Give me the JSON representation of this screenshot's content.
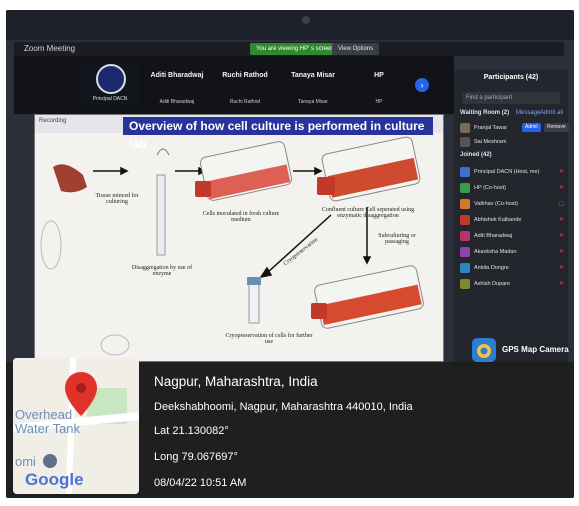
{
  "window": {
    "app_title": "Zoom Meeting",
    "viewing_banner": "You are viewing HP' s screen",
    "view_options": "View Options"
  },
  "video_strip": {
    "host_caption": "Principal DACN",
    "participants": [
      {
        "name": "Aditi Bharadwaj",
        "sub": "Aditi Bharadwaj"
      },
      {
        "name": "Ruchi Rathod",
        "sub": "Ruchi Rathod"
      },
      {
        "name": "Tanaya Misar",
        "sub": "Tanaya Misar"
      },
      {
        "name": "HP",
        "sub": "HP"
      }
    ]
  },
  "slide": {
    "recording_label": "Recording",
    "title": "Overview of how cell culture is performed in culture lab",
    "captions": {
      "minced": "Tissue minced for culturing",
      "inoculated": "Cells inoculated in fresh culture medium",
      "confluent": "Confluent culture Cell seperated using enzymatic disaggregation",
      "disaggregation": "Disaggregation by use of enzyme",
      "cryopreservation_arrow": "Cryopreservation",
      "subculturing": "Subculturing or passaging",
      "cryopreservation_cells": "Cryopreservation of cells for further use"
    }
  },
  "participants_panel": {
    "title": "Participants (42)",
    "search_placeholder": "Find a participant",
    "waiting_room_label": "Waiting Room (2)",
    "message_link": "Message",
    "admit_all_link": "Admit all",
    "waiting": [
      {
        "name": "Pranjal Tawar",
        "admit": "Admit",
        "remove": "Remove"
      },
      {
        "name": "Sai Meshram"
      }
    ],
    "joined_label": "Joined (42)",
    "joined": [
      {
        "name": "Principal DACN (Host, me)",
        "color": "#3b6fd6"
      },
      {
        "name": "HP (Co-host)",
        "color": "#3a9b4a"
      },
      {
        "name": "Vaibhav (Co-host)",
        "color": "#d67a2a"
      },
      {
        "name": "Abhishek Kalbande",
        "color": "#c0392b"
      },
      {
        "name": "Aditi Bharadwaj",
        "color": "#b8336a"
      },
      {
        "name": "Akanksha Madan",
        "color": "#8e44ad"
      },
      {
        "name": "Ankita Dongre",
        "color": "#2e86c1"
      },
      {
        "name": "Ashish Dupare",
        "color": "#7d8a2e"
      }
    ]
  },
  "map_camera_badge": "GPS Map Camera",
  "map_thumbnail": {
    "label_overhead": "Overhead",
    "label_tank": "Water Tank",
    "label_omi": "omi",
    "label_google": "Google"
  },
  "geotag": {
    "city": "Nagpur, Maharashtra, India",
    "address": "Deekshabhoomi, Nagpur, Maharashtra 440010, India",
    "lat": "Lat 21.130082°",
    "long": "Long 79.067697°",
    "datetime": "08/04/22 10:51 AM"
  }
}
